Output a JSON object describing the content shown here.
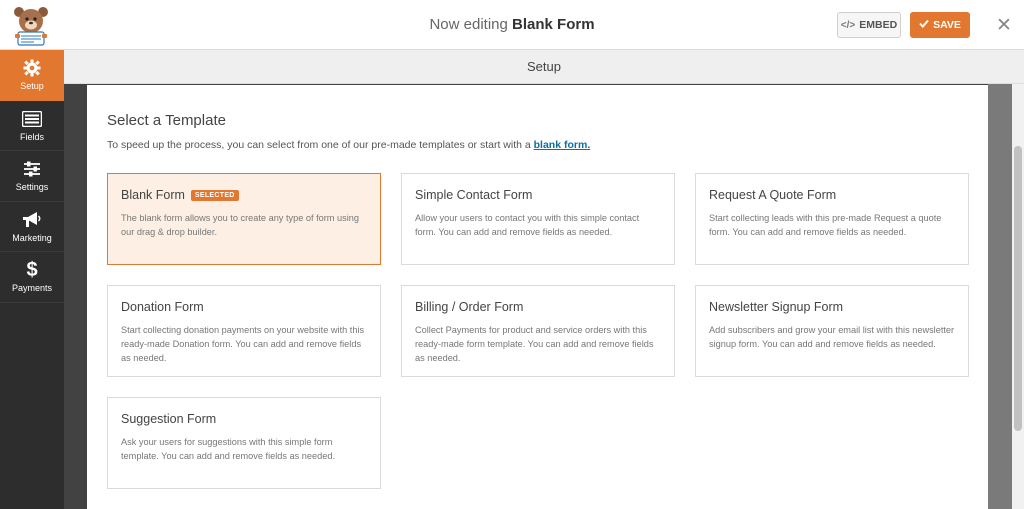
{
  "header": {
    "title_prefix": "Now editing",
    "form_name": "Blank Form",
    "embed_label": "EMBED",
    "embed_icon": "code-icon",
    "save_label": "SAVE",
    "save_icon": "checkmark-icon",
    "close_icon": "close-icon",
    "accent_color": "#e27730"
  },
  "sidebar": {
    "items": [
      {
        "label": "Setup",
        "icon": "gear-icon",
        "active": true
      },
      {
        "label": "Fields",
        "icon": "list-icon",
        "active": false
      },
      {
        "label": "Settings",
        "icon": "sliders-icon",
        "active": false
      },
      {
        "label": "Marketing",
        "icon": "megaphone-icon",
        "active": false
      },
      {
        "label": "Payments",
        "icon": "dollar-icon",
        "active": false
      }
    ]
  },
  "setup_bar": {
    "label": "Setup"
  },
  "main": {
    "heading": "Select a Template",
    "description": "To speed up the process, you can select from one of our pre-made templates or start with a",
    "blank_link": "blank form.",
    "templates": [
      {
        "title": "Blank Form",
        "badge": "SELECTED",
        "selected": true,
        "desc": "The blank form allows you to create any type of form using our drag & drop builder."
      },
      {
        "title": "Simple Contact Form",
        "selected": false,
        "desc": "Allow your users to contact you with this simple contact form. You can add and remove fields as needed."
      },
      {
        "title": "Request A Quote Form",
        "selected": false,
        "desc": "Start collecting leads with this pre-made Request a quote form. You can add and remove fields as needed."
      },
      {
        "title": "Donation Form",
        "selected": false,
        "desc": "Start collecting donation payments on your website with this ready-made Donation form. You can add and remove fields as needed."
      },
      {
        "title": "Billing / Order Form",
        "selected": false,
        "desc": "Collect Payments for product and service orders with this ready-made form template. You can add and remove fields as needed."
      },
      {
        "title": "Newsletter Signup Form",
        "selected": false,
        "desc": "Add subscribers and grow your email list with this newsletter signup form. You can add and remove fields as needed."
      },
      {
        "title": "Suggestion Form",
        "selected": false,
        "desc": "Ask your users for suggestions with this simple form template. You can add and remove fields as needed."
      }
    ]
  }
}
